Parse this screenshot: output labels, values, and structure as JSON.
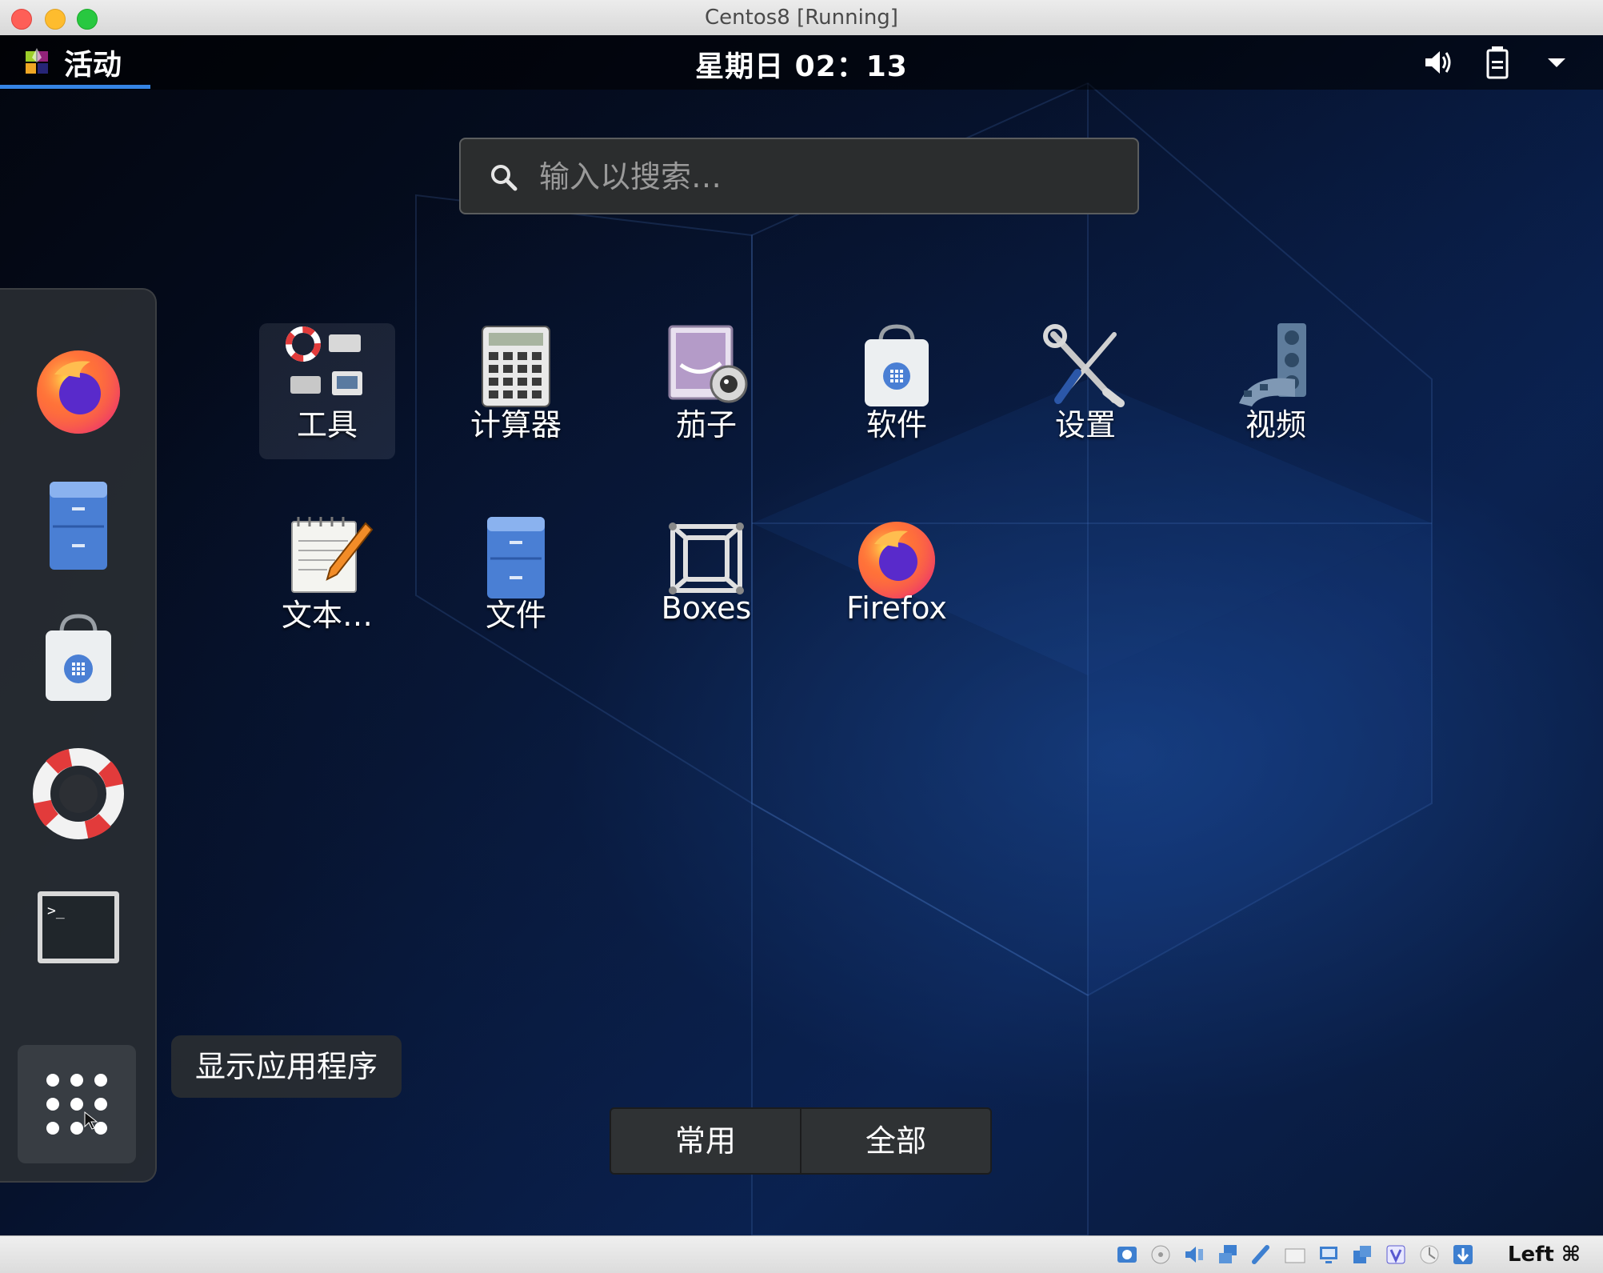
{
  "window": {
    "title": "Centos8 [Running]"
  },
  "topbar": {
    "activities_label": "活动",
    "clock": "星期日 02：13",
    "icons": [
      "volume-icon",
      "battery-icon",
      "system-menu-chevron-icon"
    ]
  },
  "search": {
    "placeholder": "输入以搜索…"
  },
  "dash": {
    "items": [
      {
        "name": "Firefox",
        "icon": "firefox-icon"
      },
      {
        "name": "文件",
        "icon": "file-cabinet-icon"
      },
      {
        "name": "软件",
        "icon": "software-bag-icon"
      },
      {
        "name": "帮助",
        "icon": "lifebuoy-icon"
      },
      {
        "name": "终端",
        "icon": "terminal-icon"
      }
    ],
    "show_apps_tooltip": "显示应用程序"
  },
  "apps": [
    {
      "label": "工具",
      "icon": "tools-folder-icon",
      "selected": true
    },
    {
      "label": "计算器",
      "icon": "calculator-icon"
    },
    {
      "label": "茄子",
      "icon": "cheese-webcam-icon"
    },
    {
      "label": "软件",
      "icon": "software-bag-icon"
    },
    {
      "label": "设置",
      "icon": "settings-tools-icon"
    },
    {
      "label": "视频",
      "icon": "video-film-icon"
    },
    {
      "label": "文本…",
      "icon": "text-editor-icon"
    },
    {
      "label": "文件",
      "icon": "file-cabinet-icon"
    },
    {
      "label": "Boxes",
      "icon": "boxes-icon"
    },
    {
      "label": "Firefox",
      "icon": "firefox-icon"
    }
  ],
  "view_toggle": {
    "frequent": "常用",
    "all": "全部"
  },
  "statusbar": {
    "host_key": "Left ⌘"
  },
  "colors": {
    "accent": "#3584e4",
    "panel": "#000000",
    "dash_bg": "#282c32"
  }
}
